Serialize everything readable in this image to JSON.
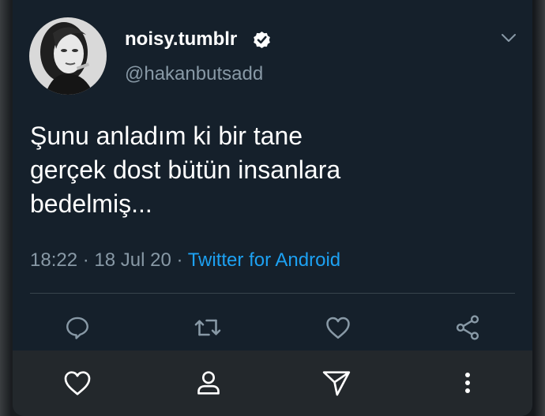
{
  "tweet": {
    "display_name": "noisy.tumblr",
    "handle": "@hakanbutsadd",
    "verified": true,
    "text_lines": [
      "Şunu anladım ki bir tane",
      "gerçek dost bütün insanlara",
      "bedelmiş..."
    ],
    "time": "18:22",
    "date": "18 Jul 20",
    "separator": "·",
    "source": "Twitter for Android"
  },
  "actions": [
    "reply-icon",
    "retweet-icon",
    "like-icon",
    "share-icon"
  ],
  "navbar": [
    "heart-icon",
    "person-icon",
    "send-icon",
    "more-vertical-icon"
  ],
  "colors": {
    "background": "#15202b",
    "text": "#ffffff",
    "secondary": "#8899a6",
    "accent": "#1da1f2",
    "navbar": "#23282c"
  }
}
